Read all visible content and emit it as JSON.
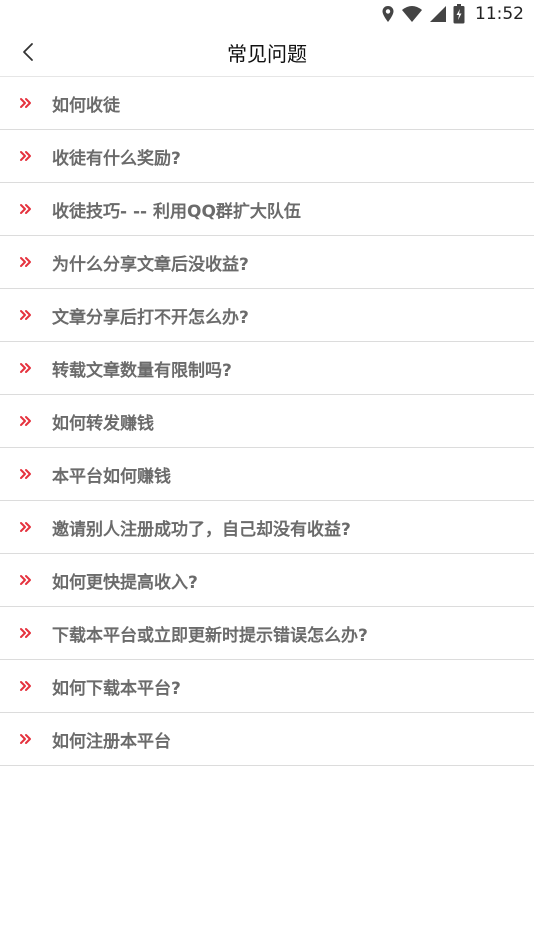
{
  "status_bar": {
    "time": "11:52",
    "icons": [
      "location-icon",
      "wifi-icon",
      "signal-icon",
      "battery-icon"
    ]
  },
  "header": {
    "title": "常见问题",
    "back_icon": "back-chevron-icon"
  },
  "colors": {
    "accent": "#e5323e",
    "item_text": "#6b6b6b",
    "divider": "#dcdcdc"
  },
  "faq": [
    {
      "label": "如何收徒"
    },
    {
      "label": "收徒有什么奖励?"
    },
    {
      "label": "收徒技巧- -- 利用QQ群扩大队伍"
    },
    {
      "label": "为什么分享文章后没收益?"
    },
    {
      "label": "文章分享后打不开怎么办?"
    },
    {
      "label": "转载文章数量有限制吗?"
    },
    {
      "label": "如何转发赚钱"
    },
    {
      "label": "本平台如何赚钱"
    },
    {
      "label": "邀请别人注册成功了，自己却没有收益?"
    },
    {
      "label": "如何更快提高收入?"
    },
    {
      "label": "下载本平台或立即更新时提示错误怎么办?"
    },
    {
      "label": "如何下载本平台?"
    },
    {
      "label": "如何注册本平台"
    }
  ]
}
